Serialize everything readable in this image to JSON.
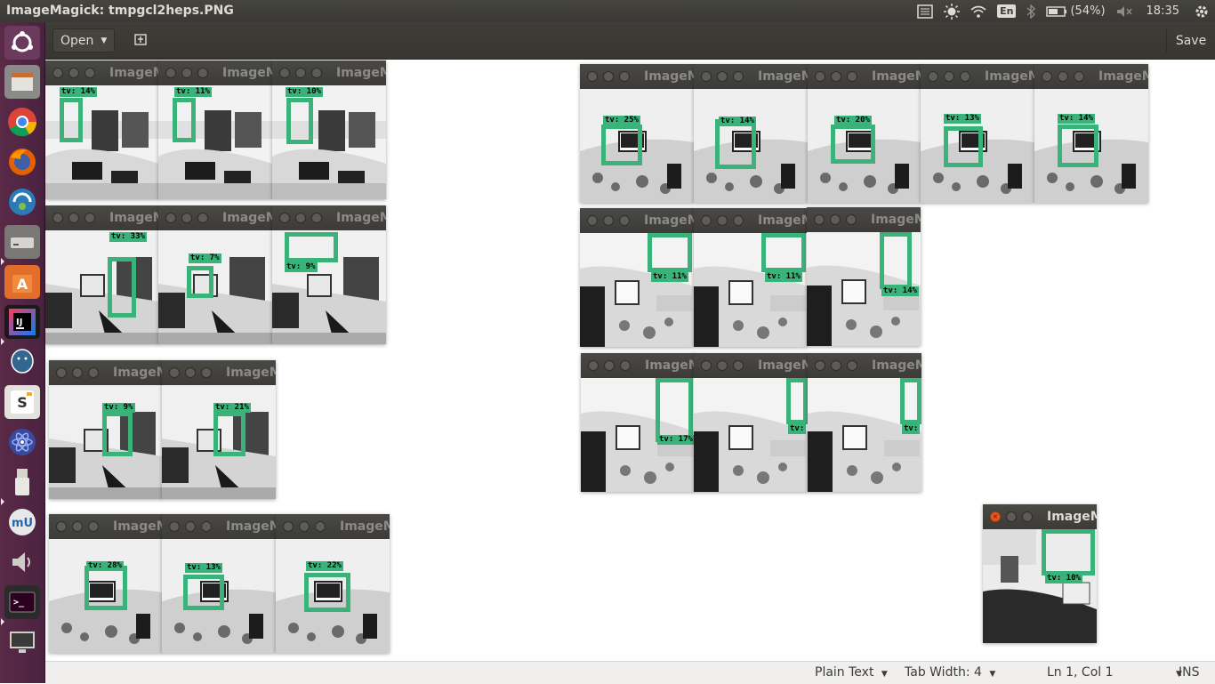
{
  "window_title": "ImageMagick: tmpgcl2heps.PNG",
  "tray": {
    "language": "En",
    "battery": "(54%)",
    "time": "18:35",
    "icons": [
      "messages-icon",
      "brightness-icon",
      "wifi-icon",
      "bluetooth-icon",
      "battery-icon",
      "volume-muted-icon",
      "settings-gear-icon"
    ]
  },
  "launcher": {
    "items": [
      "ubuntu-dash-icon",
      "file-manager-icon",
      "chrome-icon",
      "firefox-icon",
      "software-updater-icon",
      "drive-icon",
      "software-center-icon",
      "intellij-icon",
      "postgresql-icon",
      "sublime-icon",
      "atom-icon",
      "usb-icon",
      "musescore-icon",
      "sound-icon",
      "terminal-icon",
      "display-icon"
    ]
  },
  "toolbar": {
    "open_label": "Open",
    "save_label": "Save"
  },
  "statusbar": {
    "language": "Plain Text",
    "tab_width": "Tab Width: 4",
    "position": "Ln 1, Col 1",
    "mode": "INS"
  },
  "image_window_title": "ImageMagick",
  "detections": [
    {
      "label": "tv: 14%"
    },
    {
      "label": "tv: 11%"
    },
    {
      "label": "tv: 10%"
    },
    {
      "label": "tv: 33%"
    },
    {
      "label": "tv: 7%"
    },
    {
      "label": "tv: 9%"
    },
    {
      "label": "tv: 9%"
    },
    {
      "label": "tv: 21%"
    },
    {
      "label": "tv: 28%"
    },
    {
      "label": "tv: 13%"
    },
    {
      "label": "tv: 22%"
    },
    {
      "label": "tv: 25%"
    },
    {
      "label": "tv: 14%"
    },
    {
      "label": "tv: 20%"
    },
    {
      "label": "tv: 13%"
    },
    {
      "label": "tv: 14%"
    },
    {
      "label": "tv: 11%"
    },
    {
      "label": "tv: 11%"
    },
    {
      "label": "tv: 14%"
    },
    {
      "label": "tv: 17%"
    },
    {
      "label": "tv:"
    },
    {
      "label": "tv:"
    },
    {
      "label": "tv: 10%"
    }
  ]
}
